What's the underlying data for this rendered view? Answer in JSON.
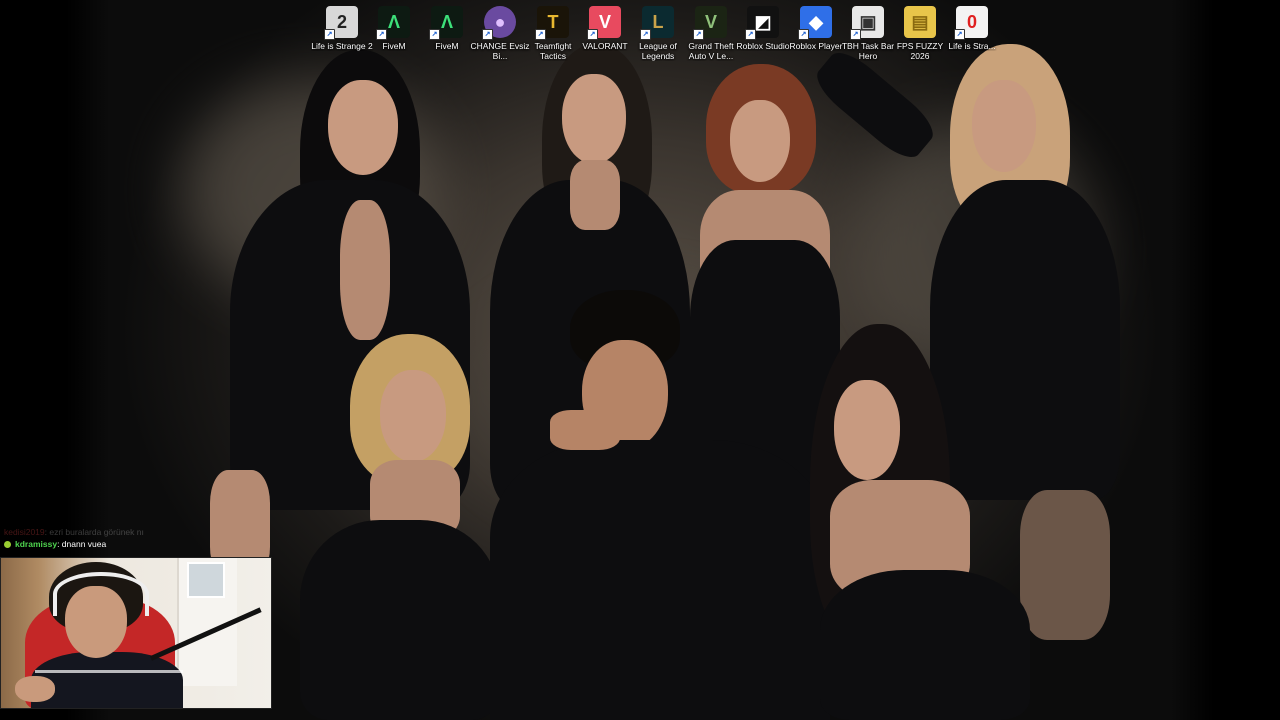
{
  "desktop": {
    "icons": [
      {
        "label": "Life is Strange 2",
        "glyph": "2",
        "icon": "life-is-strange-2-icon",
        "bg": "#d8d8d8",
        "fg": "#222222"
      },
      {
        "label": "FiveM",
        "glyph": "Λ",
        "icon": "fivem-icon",
        "bg": "#0d1a12",
        "fg": "#3de07a"
      },
      {
        "label": "FiveM",
        "glyph": "Λ",
        "icon": "fivem-icon",
        "bg": "#0d1a12",
        "fg": "#3de07a"
      },
      {
        "label": "CHANGE Evsiz Bi...",
        "glyph": "●",
        "icon": "change-game-icon",
        "bg": "#6a4aa0",
        "fg": "#e0c0ff"
      },
      {
        "label": "Teamfight Tactics",
        "glyph": "T",
        "icon": "teamfight-tactics-icon",
        "bg": "#1a1408",
        "fg": "#e8b830"
      },
      {
        "label": "VALORANT",
        "glyph": "V",
        "icon": "valorant-icon",
        "bg": "#e84a5f",
        "fg": "#ffffff"
      },
      {
        "label": "League of Legends",
        "glyph": "L",
        "icon": "league-of-legends-icon",
        "bg": "#0b2a30",
        "fg": "#c9a34a"
      },
      {
        "label": "Grand Theft Auto V Le...",
        "glyph": "V",
        "icon": "gta-v-icon",
        "bg": "#1b2414",
        "fg": "#8fc17a"
      },
      {
        "label": "Roblox Studio",
        "glyph": "◩",
        "icon": "roblox-studio-icon",
        "bg": "#111111",
        "fg": "#ffffff"
      },
      {
        "label": "Roblox Player",
        "glyph": "◆",
        "icon": "roblox-player-icon",
        "bg": "#2f6fe8",
        "fg": "#ffffff"
      },
      {
        "label": "TBH Task Bar Hero",
        "glyph": "▣",
        "icon": "tbh-task-bar-hero-icon",
        "bg": "#e8e8e8",
        "fg": "#333333"
      },
      {
        "label": "FPS FUZZY 2026",
        "glyph": "▤",
        "icon": "folder-icon",
        "bg": "#e8c54a",
        "fg": "#8a6a10"
      },
      {
        "label": "Life is Stra...",
        "glyph": "0",
        "icon": "life-is-strange-icon",
        "bg": "#f3f3f3",
        "fg": "#e02020"
      }
    ]
  },
  "chat": {
    "faded_user": "kedisi2019",
    "faded_message": ": ezri buralarda görünek nı",
    "user": "kdramissy",
    "message": ": dnann vuea"
  },
  "webcam": {
    "label": "streamer webcam"
  },
  "colors": {
    "chat_user": "#4fd34f",
    "chair": "#c42727"
  }
}
